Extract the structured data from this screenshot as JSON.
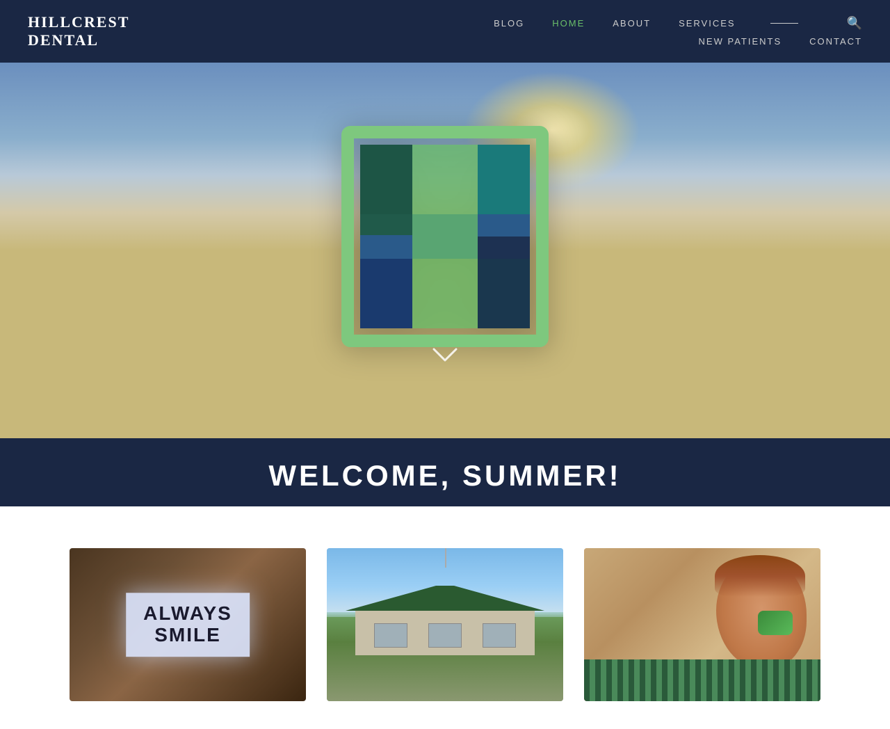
{
  "site": {
    "logo_line1": "HILLCREST",
    "logo_line2": "DENTAL"
  },
  "nav": {
    "row1": [
      {
        "id": "blog",
        "label": "BLOG",
        "active": false
      },
      {
        "id": "home",
        "label": "HOME",
        "active": true
      },
      {
        "id": "about",
        "label": "ABOUT",
        "active": false
      },
      {
        "id": "services",
        "label": "SERVICES",
        "active": false
      }
    ],
    "row2": [
      {
        "id": "new-patients",
        "label": "NEW PATIENTS",
        "active": false
      },
      {
        "id": "contact",
        "label": "CONTACT",
        "active": false
      }
    ]
  },
  "hero": {
    "chevron": "⌄",
    "welcome_text": "WELCOME, SUMMER!"
  },
  "cards": [
    {
      "id": "card-smile",
      "alt": "Always Smile sign",
      "sign_line1": "ALWAYS",
      "sign_line2": "SMILE"
    },
    {
      "id": "card-building",
      "alt": "Hillcrest Dental building exterior"
    },
    {
      "id": "card-boy",
      "alt": "Boy smiling with dental toy"
    }
  ],
  "colors": {
    "nav_bg": "#1a2744",
    "active_green": "#6abf69",
    "nav_text": "#cccccc"
  }
}
